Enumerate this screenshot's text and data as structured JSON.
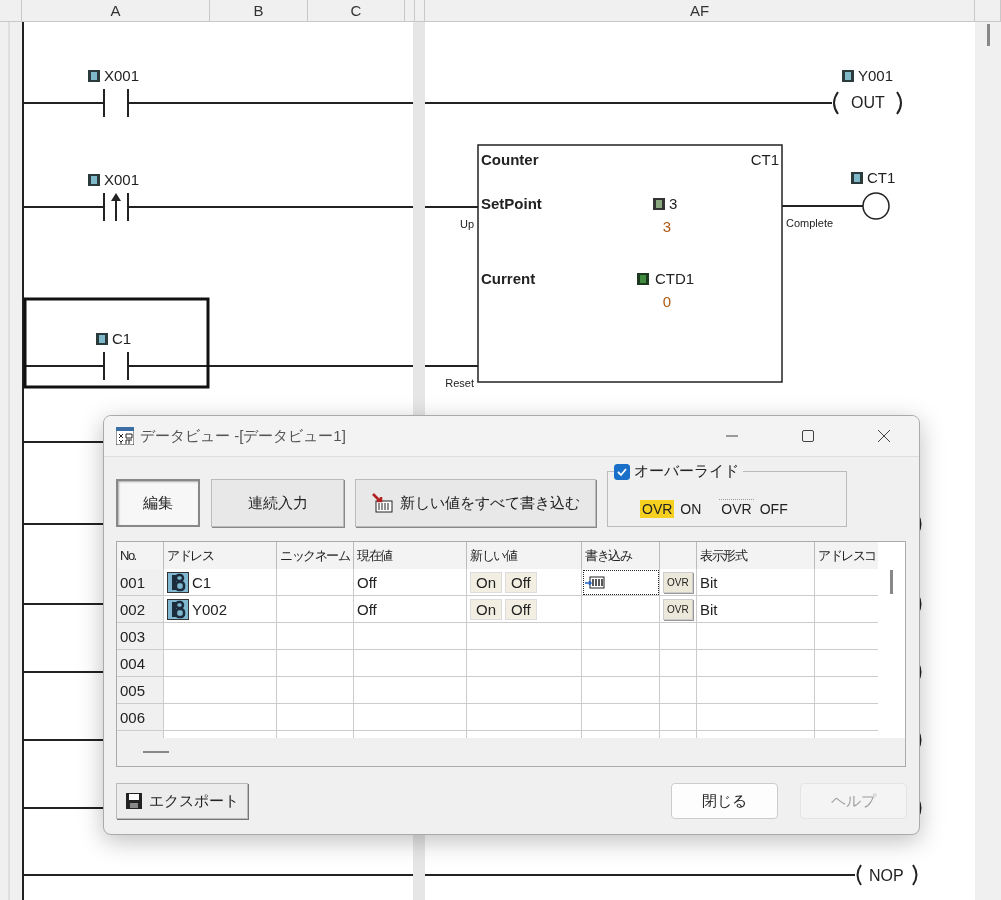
{
  "ladder": {
    "column_headers": [
      "A",
      "B",
      "C",
      "AF"
    ],
    "rungs": [
      {
        "contact": {
          "kind": "no",
          "address": "X001",
          "selected": false
        },
        "coil": {
          "address": "Y001",
          "instruction": "OUT"
        }
      },
      {
        "contact": {
          "kind": "rising",
          "address": "X001",
          "selected": false
        },
        "input_label": "Up"
      },
      {
        "contact": {
          "kind": "no",
          "address": "C1",
          "selected": true
        },
        "input_label": "Reset"
      }
    ],
    "counter": {
      "title": "Counter",
      "id": "CT1",
      "setpoint_label": "SetPoint",
      "setpoint_address": "3",
      "setpoint_value": "3",
      "current_label": "Current",
      "current_address": "CTD1",
      "current_value": "0",
      "output_label": "Complete",
      "output_address": "CT1"
    },
    "nop_rung": {
      "instruction": "NOP"
    }
  },
  "dialog": {
    "title": "データビュー -[データビュー1]",
    "mode_buttons": [
      {
        "label": "編集",
        "selected": true
      },
      {
        "label": "連続入力",
        "selected": false
      }
    ],
    "write_all_button": "新しい値をすべて書き込む",
    "override": {
      "label": "オーバーライド",
      "checked": true,
      "indicators": [
        {
          "badge": "OVR",
          "label": "ON",
          "selected": true
        },
        {
          "badge": "OVR",
          "label": "OFF",
          "selected": false
        }
      ]
    },
    "table": {
      "columns": [
        {
          "label": "No."
        },
        {
          "label": "アドレス"
        },
        {
          "label": "ニックネーム"
        },
        {
          "label": "現在値"
        },
        {
          "label": "新しい値"
        },
        {
          "label": "書き込み"
        },
        {},
        {
          "label": "表示形式"
        },
        {
          "label": "アドレスコ"
        }
      ],
      "rows": [
        {
          "no": "001",
          "address": "C1",
          "current": "Off",
          "on_button": "On",
          "off_button": "Off",
          "write_focused": true,
          "ovr_button": "OVR",
          "format": "Bit"
        },
        {
          "no": "002",
          "address": "Y002",
          "current": "Off",
          "on_button": "On",
          "off_button": "Off",
          "write_focused": false,
          "ovr_button": "OVR",
          "format": "Bit"
        },
        {
          "no": "003"
        },
        {
          "no": "004"
        },
        {
          "no": "005"
        },
        {
          "no": "006"
        }
      ]
    },
    "export_button": "エクスポート",
    "close_button": "閉じる",
    "help_button": {
      "label": "ヘルプ",
      "disabled": true
    }
  }
}
